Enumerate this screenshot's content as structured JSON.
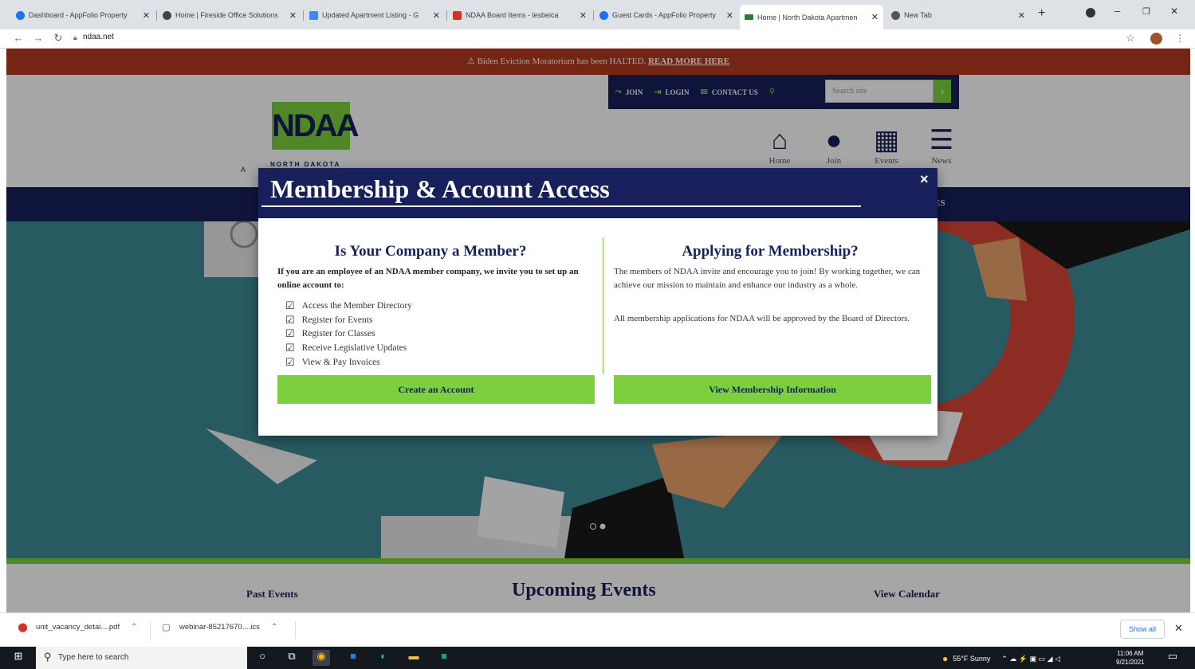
{
  "browser": {
    "tabs": [
      {
        "label": "Dashboard - AppFolio Property",
        "color": "#1a73e8"
      },
      {
        "label": "Home | Fireside Office Solutions",
        "color": "#444444"
      },
      {
        "label": "Updated Apartment Listing - G",
        "color": "#4285f4"
      },
      {
        "label": "NDAA Board Items - lesbeica",
        "color": "#d93025"
      },
      {
        "label": "Guest Cards - AppFolio Property",
        "color": "#1a73e8"
      },
      {
        "label": "Home | North Dakota Apartmen",
        "color": "#2e7d32"
      },
      {
        "label": "New Tab",
        "color": "#555555"
      }
    ],
    "active_tab": 5,
    "url": "ndaa.net"
  },
  "site": {
    "alert_text": "Biden Eviction Moratorium has been HALTED.",
    "alert_link": "READ MORE HERE",
    "top_nav": [
      {
        "label": "JOIN",
        "icon": "handshake-icon"
      },
      {
        "label": "LOGIN",
        "icon": "login-icon"
      },
      {
        "label": "CONTACT US",
        "icon": "mail-icon"
      }
    ],
    "search_placeholder": "Search site",
    "logo_text": "NDAA",
    "logo_subtext": "NORTH DAKOTA",
    "logo_side_letter": "A",
    "quick_links": [
      {
        "label": "Home",
        "icon": "home-icon"
      },
      {
        "label": "Join",
        "icon": "person-icon"
      },
      {
        "label": "Events",
        "icon": "calendar-icon"
      },
      {
        "label": "News",
        "icon": "newspaper-icon"
      }
    ],
    "main_nav_fragment": "ES",
    "events": {
      "past": "Past Events",
      "title": "Upcoming Events",
      "calendar": "View Calendar"
    }
  },
  "modal": {
    "title": "Membership & Account Access",
    "close": "×",
    "left": {
      "heading": "Is Your Company a Member?",
      "intro": "If you are an employee of an NDAA member company, we invite you to set up an online account to:",
      "checklist": [
        "Access the Member Directory",
        "Register for Events",
        "Register for Classes",
        "Receive Legislative Updates",
        "View & Pay Invoices"
      ],
      "button": "Create an Account"
    },
    "right": {
      "heading": "Applying for Membership?",
      "para1": "The members of NDAA invite and encourage you to join! By working together, we can achieve our mission to maintain and enhance our industry as a whole.",
      "para2": "All membership applications for NDAA will be approved by the Board of Directors.",
      "button": "View Membership Information"
    }
  },
  "downloads": {
    "items": [
      {
        "name": "unit_vacancy_detai....pdf"
      },
      {
        "name": "webinar-85217670....ics"
      }
    ],
    "show_all": "Show all"
  },
  "taskbar": {
    "search_placeholder": "Type here to search",
    "weather": "55°F  Sunny",
    "time": "11:06 AM",
    "date": "9/21/2021"
  },
  "colors": {
    "navy": "#17205a",
    "green": "#7ccf3d",
    "alert": "#b33a20",
    "hero": "#3d8a96"
  }
}
